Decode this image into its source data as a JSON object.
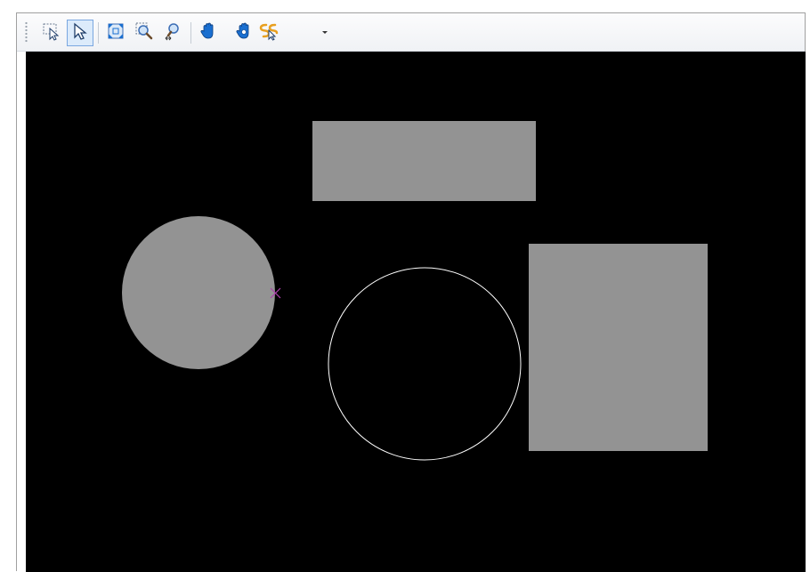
{
  "toolbar": {
    "buttons": [
      {
        "name": "lasso-select-button",
        "icon": "lasso-select-icon",
        "active": false
      },
      {
        "name": "select-pointer-button",
        "icon": "arrow-pointer-icon",
        "active": true
      },
      {
        "name": "zoom-extents-button",
        "icon": "zoom-extents-icon",
        "active": false
      },
      {
        "name": "zoom-window-button",
        "icon": "zoom-window-icon",
        "active": false
      },
      {
        "name": "zoom-realtime-button",
        "icon": "zoom-realtime-icon",
        "active": false
      },
      {
        "name": "pan-button",
        "icon": "hand-icon",
        "active": false
      },
      {
        "name": "pan-realtime-button",
        "icon": "hand-realtime-icon",
        "active": false
      },
      {
        "name": "snap-button",
        "icon": "snap-icon",
        "active": false
      }
    ]
  },
  "canvas": {
    "background_color": "#000000",
    "shape_fill_color": "#939393",
    "outline_color": "#ffffff",
    "snap_marker_color": "#b040b0",
    "shapes": [
      {
        "type": "rectangle",
        "style": "filled"
      },
      {
        "type": "circle",
        "style": "filled"
      },
      {
        "type": "circle",
        "style": "outline"
      },
      {
        "type": "rectangle",
        "style": "filled"
      }
    ],
    "snap_marker": "x-marker-icon"
  },
  "colors": {
    "active_button_bg": "#dcebfb",
    "active_button_border": "#7aa7e0",
    "icon_blue": "#1a6fd0",
    "icon_orange": "#e8a020"
  }
}
